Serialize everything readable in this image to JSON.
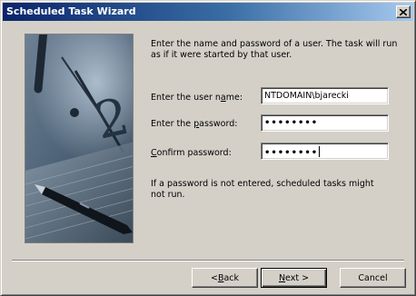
{
  "window": {
    "title": "Scheduled Task Wizard"
  },
  "intro_text": "Enter the name and password of a user.  The task will run as if it were started by that user.",
  "fields": {
    "username": {
      "label_pre": "Enter the user n",
      "label_key": "a",
      "label_post": "me:",
      "value": "NTDOMAIN\\bjarecki"
    },
    "password": {
      "label_pre": "Enter the ",
      "label_key": "p",
      "label_post": "assword:",
      "value": "••••••••"
    },
    "confirm": {
      "label_pre": "",
      "label_key": "C",
      "label_post": "onfirm password:",
      "value": "••••••••"
    }
  },
  "warning_text": "If a password is not entered, scheduled tasks might not run.",
  "buttons": {
    "back": {
      "pre": "< ",
      "key": "B",
      "post": "ack"
    },
    "next": {
      "pre": "",
      "key": "N",
      "post": "ext >"
    },
    "cancel": "Cancel"
  },
  "icons": {
    "close": "close-icon"
  },
  "colors": {
    "titlebar_start": "#0a246a",
    "titlebar_end": "#a6caf0",
    "face": "#d4d0c8"
  }
}
